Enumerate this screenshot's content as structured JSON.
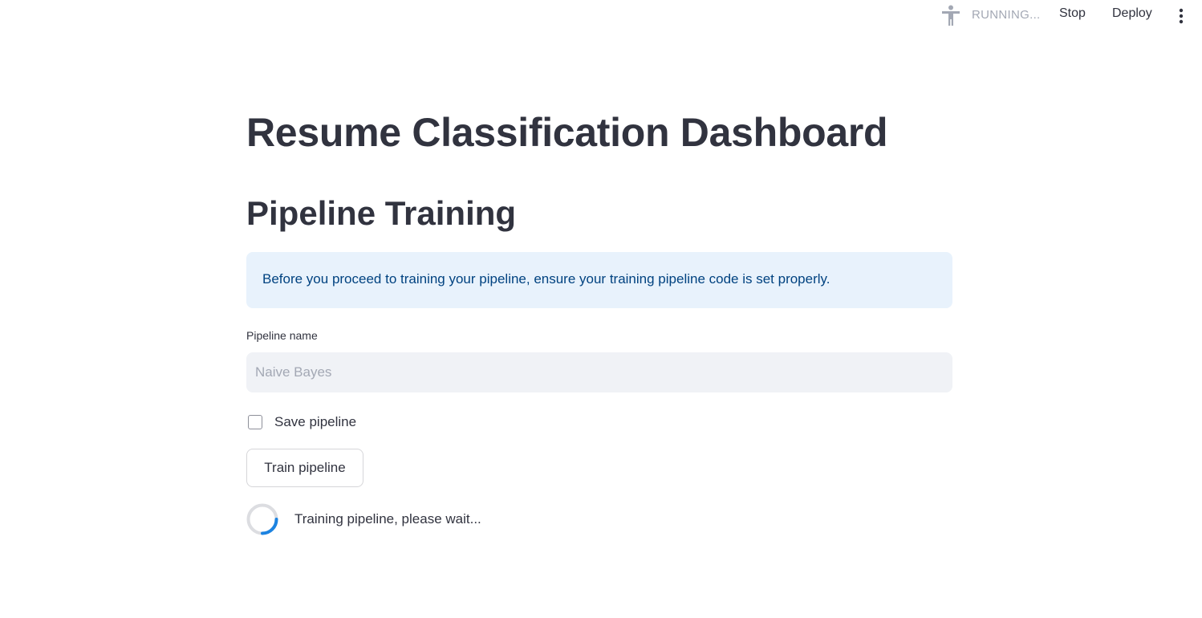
{
  "toolbar": {
    "status_text": "RUNNING...",
    "stop_label": "Stop",
    "deploy_label": "Deploy",
    "status_icon": "running-man-icon",
    "menu_icon": "kebab-menu-icon"
  },
  "main": {
    "title": "Resume Classification Dashboard",
    "section_title": "Pipeline Training",
    "info_message": "Before you proceed to training your pipeline, ensure your training pipeline code is set properly.",
    "pipeline_name_label": "Pipeline name",
    "pipeline_name_value": "",
    "pipeline_name_placeholder": "Naive Bayes",
    "save_pipeline_label": "Save pipeline",
    "save_pipeline_checked": false,
    "train_button_label": "Train pipeline",
    "spinner_text": "Training pipeline, please wait..."
  },
  "colors": {
    "info_bg": "#e8f2fc",
    "info_text": "#004280",
    "input_bg": "#f0f2f6",
    "spinner_accent": "#1c83e1",
    "text": "#31333f",
    "muted": "#a3a8b4"
  }
}
